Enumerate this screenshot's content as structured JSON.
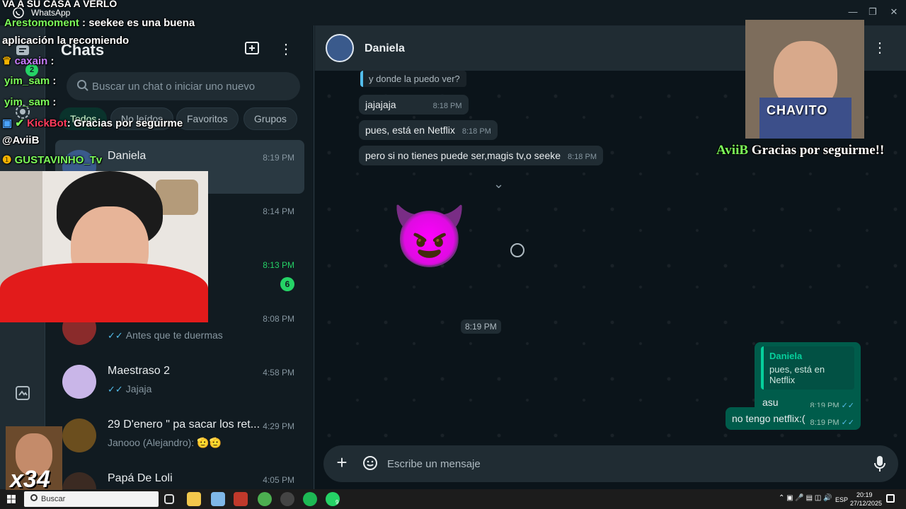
{
  "window": {
    "title": "WhatsApp"
  },
  "rail": {
    "unread_badge": "2"
  },
  "sidebar": {
    "title": "Chats",
    "search_placeholder": "Buscar un chat o iniciar uno nuevo",
    "filters": [
      "Todos",
      "No leídos",
      "Favoritos",
      "Grupos"
    ],
    "chats": [
      {
        "name": "Daniela",
        "time": "8:19 PM",
        "preview": "",
        "selected": true
      },
      {
        "name": "",
        "time": "8:14 PM",
        "preview": ""
      },
      {
        "name": "",
        "time": "8:13 PM",
        "preview": "",
        "unread": "6"
      },
      {
        "name": "",
        "time": "8:08 PM",
        "preview": "Antes que te duermas"
      },
      {
        "name": "Maestraso 2",
        "time": "4:58 PM",
        "preview": "Jajaja"
      },
      {
        "name": "29 D'enero \" pa sacar los ret...",
        "time": "4:29 PM",
        "preview": "Janooo (Alejandro): 🫡🫡"
      },
      {
        "name": "Papá De Loli",
        "time": "4:05 PM",
        "preview": ""
      }
    ]
  },
  "conversation": {
    "contact_name": "Daniela",
    "incoming": [
      {
        "text": "y donde la puedo ver?",
        "quoted": true
      },
      {
        "text": "jajajaja",
        "time": "8:18 PM"
      },
      {
        "text": "pues, está en Netflix",
        "time": "8:18 PM"
      },
      {
        "text": "pero si no tienes puede ser,magis tv,o seeke",
        "time": "8:18 PM"
      }
    ],
    "sticker_emoji": "😈",
    "sticker_time": "8:19 PM",
    "outgoing": [
      {
        "quote_author": "Daniela",
        "quote_text": "pues, está en Netflix",
        "text": "asu",
        "time": "8:19 PM"
      },
      {
        "text": "no tengo netflix:(",
        "time": "8:19 PM"
      }
    ],
    "composer_placeholder": "Escribe un mensaje"
  },
  "stream_overlay": {
    "top_line": "VA A SU CASA A VERLO",
    "chat": [
      {
        "user": "Arestomoment",
        "text": ": seekee es una buena",
        "user_color": "#7CFC5A"
      },
      {
        "user": "",
        "text": "aplicación la recomiendo",
        "user_color": "#ffffff"
      },
      {
        "user": "caxain",
        "text": ":",
        "user_color": "#c77dff"
      },
      {
        "user": "yim_sam",
        "text": ":",
        "user_color": "#7CFC5A"
      },
      {
        "user": "yim_sam",
        "text": ":",
        "user_color": "#7CFC5A"
      },
      {
        "user": "KickBot",
        "text": ": Gracias por seguirme",
        "user_color": "#ff3b5c"
      },
      {
        "user": "@AviiB",
        "text": "",
        "user_color": "#ffffff"
      },
      {
        "user": "GUSTAVINHO_Tv",
        "text": "",
        "user_color": "#7CFC5A"
      }
    ],
    "cam_label": "CHAVITO",
    "thanks_user": "AviiB",
    "thanks_text": "Gracias por seguirme!!",
    "combo": "x34"
  },
  "taskbar": {
    "search_label": "Buscar",
    "lang": "ESP",
    "time": "20:19",
    "date": "27/12/2025",
    "whatsapp_badge": "9"
  },
  "colors": {
    "accent": "#25d366",
    "outgoing_bubble": "#005c4b",
    "incoming_bubble": "#202c33",
    "panel": "#111b21"
  }
}
